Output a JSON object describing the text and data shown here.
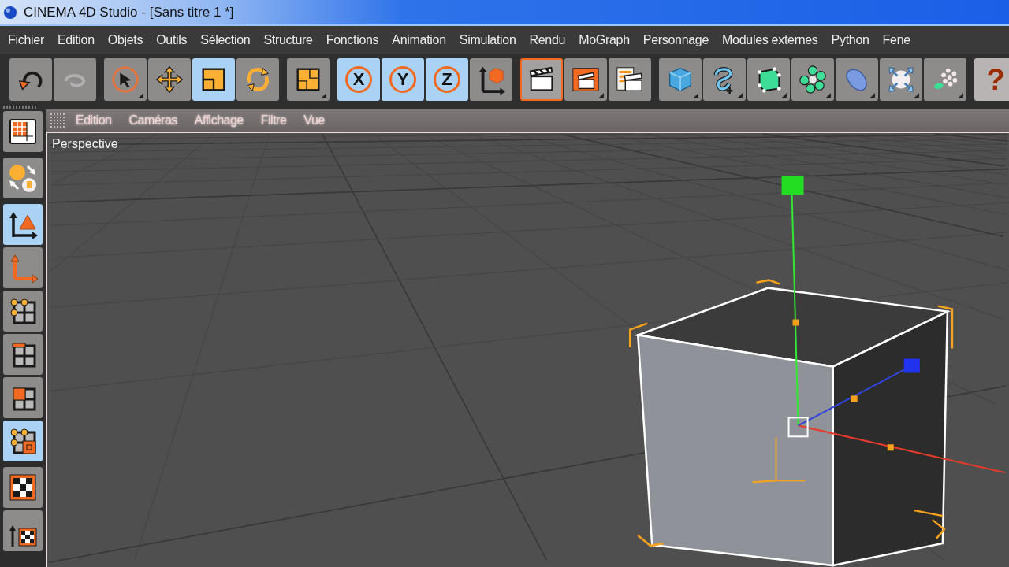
{
  "window": {
    "title": "CINEMA 4D Studio - [Sans titre 1 *]"
  },
  "menu": [
    "Fichier",
    "Edition",
    "Objets",
    "Outils",
    "Sélection",
    "Structure",
    "Fonctions",
    "Animation",
    "Simulation",
    "Rendu",
    "MoGraph",
    "Personnage",
    "Modules externes",
    "Python",
    "Fene"
  ],
  "toolbar": {
    "groups": [
      {
        "buttons": [
          {
            "selected": false,
            "active": false,
            "submenu": false
          },
          {
            "selected": false,
            "active": false,
            "submenu": false
          }
        ]
      },
      {
        "buttons": [
          {
            "selected": false,
            "active": false,
            "submenu": true
          },
          {
            "selected": false,
            "active": false,
            "submenu": false
          },
          {
            "selected": true,
            "active": false,
            "submenu": false
          },
          {
            "selected": false,
            "active": false,
            "submenu": false
          }
        ]
      },
      {
        "buttons": [
          {
            "selected": false,
            "active": false,
            "submenu": true
          }
        ]
      },
      {
        "buttons": [
          {
            "selected": true,
            "active": false,
            "submenu": false,
            "label": "X"
          },
          {
            "selected": true,
            "active": false,
            "submenu": false,
            "label": "Y"
          },
          {
            "selected": true,
            "active": false,
            "submenu": false,
            "label": "Z"
          },
          {
            "selected": false,
            "active": false,
            "submenu": false
          }
        ]
      },
      {
        "buttons": [
          {
            "selected": false,
            "active": true,
            "submenu": false
          },
          {
            "selected": false,
            "active": false,
            "submenu": true
          },
          {
            "selected": false,
            "active": false,
            "submenu": false
          }
        ]
      },
      {
        "buttons": [
          {
            "selected": false,
            "active": false,
            "submenu": true
          },
          {
            "selected": false,
            "active": false,
            "submenu": true
          },
          {
            "selected": false,
            "active": false,
            "submenu": true
          },
          {
            "selected": false,
            "active": false,
            "submenu": true
          },
          {
            "selected": false,
            "active": false,
            "submenu": true
          },
          {
            "selected": false,
            "active": false,
            "submenu": true
          },
          {
            "selected": false,
            "active": false,
            "submenu": true
          }
        ]
      },
      {
        "buttons": [
          {
            "selected": false,
            "active": false,
            "label": "?"
          }
        ]
      }
    ]
  },
  "sidebar": {
    "buttons": [
      {
        "selected": false
      },
      {
        "selected": false
      },
      {
        "selected": true
      },
      {
        "selected": false
      },
      {
        "selected": false
      },
      {
        "selected": false
      },
      {
        "selected": false
      },
      {
        "selected": true
      },
      {
        "selected": false
      },
      {
        "selected": false
      }
    ]
  },
  "viewport": {
    "menu": [
      "Edition",
      "Caméras",
      "Affichage",
      "Filtre",
      "Vue"
    ],
    "label": "Perspective"
  }
}
